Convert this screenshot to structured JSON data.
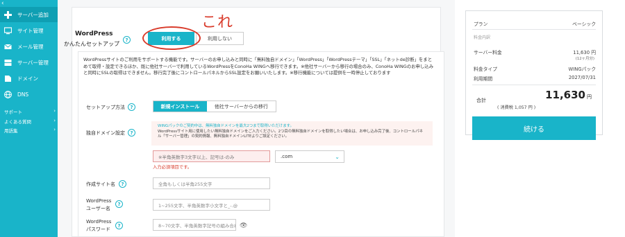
{
  "sidebar": {
    "collapse": "‹",
    "items": [
      {
        "label": "サーバー追加",
        "icon": "plus-icon"
      },
      {
        "label": "サイト管理",
        "icon": "monitor-icon"
      },
      {
        "label": "メール管理",
        "icon": "mail-icon"
      },
      {
        "label": "サーバー管理",
        "icon": "server-icon"
      },
      {
        "label": "ドメイン",
        "icon": "domain-icon"
      },
      {
        "label": "DNS",
        "icon": "globe-icon"
      }
    ],
    "links": [
      {
        "label": "サポート"
      },
      {
        "label": "よくある質問"
      },
      {
        "label": "用語集"
      }
    ]
  },
  "setup": {
    "title_line1": "WordPress",
    "title_line2": "かんたんセットアップ",
    "use_label": "利用する",
    "no_use_label": "利用しない",
    "annotation": "これ",
    "description": "WordPressサイトのご利用をサポートする機能です。サーバーのお申し込みと同時に「無料独自ドメイン」「WordPress」「WordPressテーマ」「SSL」「ネットde診断」をまとめて取得・設定できるほか、既に他社サーバーで利用しているWordPressをConoHa WINGへ移行できます。※他社サーバーから移行の場合のみ、ConoHa WINGのお申し込みと同時にSSLの取得はできません。移行完了後にコントロールパネルからSSL設定をお願いいたします。※移行機能については提供を一時停止しております"
  },
  "form": {
    "method_label": "セットアップ方法",
    "method_options": [
      "新規インストール",
      "他社サーバーからの移行"
    ],
    "domain_label": "独自ドメイン設定",
    "notice_line1": "WINGパックのご契約中は、無料独自ドメインを最大2つまで取得いただけます。",
    "notice_line2": "WordPressサイト用に使用したい無料独自ドメインをご入力ください。2つ目の無料独自ドメインを取得したい場合は、お申し込み完了後、コントロールパネル「サーバー管理」の契約情報、無料独自ドメインLITEよりご設定ください。",
    "domain_placeholder": "※半角英数字3文字以上、記号は-のみ",
    "domain_suffix": ".com",
    "domain_error": "入力必須項目です。",
    "site_name_label": "作成サイト名",
    "site_name_placeholder": "全角もしくは半角255文字",
    "user_label_1": "WordPress",
    "user_label_2": "ユーザー名",
    "user_placeholder": "1~255文字、半角英数字小文字と_-.@",
    "pass_label_1": "WordPress",
    "pass_label_2": "パスワード",
    "pass_placeholder": "8~70文字、半角英数字記号の組み合わせ"
  },
  "summary": {
    "plan_label": "プラン",
    "plan_value": "ベーシック",
    "breakdown_label": "料金内訳",
    "server_fee_label": "サーバー料金",
    "server_fee_value": "11,630 円",
    "server_fee_months": "(12ヶ月分)",
    "fee_type_label": "料金タイプ",
    "fee_type_value": "WINGパック",
    "period_label": "利用期間",
    "period_value": "2027/07/31",
    "total_label": "合計",
    "total_value": "11,630",
    "total_unit": "円",
    "total_tax": "( 消費税  1,057 円 )",
    "continue_label": "続ける"
  },
  "colors": {
    "accent": "#19b4c9",
    "annotation": "#d93b2b"
  }
}
